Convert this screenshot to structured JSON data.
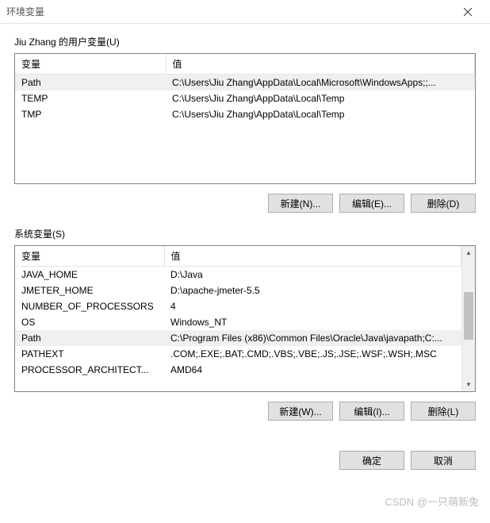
{
  "window": {
    "title": "环境变量"
  },
  "user_section": {
    "label": "Jiu Zhang 的用户变量(U)",
    "headers": {
      "name": "变量",
      "value": "值"
    },
    "rows": [
      {
        "name": "Path",
        "value": "C:\\Users\\Jiu Zhang\\AppData\\Local\\Microsoft\\WindowsApps;;...",
        "selected": true
      },
      {
        "name": "TEMP",
        "value": "C:\\Users\\Jiu Zhang\\AppData\\Local\\Temp",
        "selected": false
      },
      {
        "name": "TMP",
        "value": "C:\\Users\\Jiu Zhang\\AppData\\Local\\Temp",
        "selected": false
      }
    ],
    "buttons": {
      "new": "新建(N)...",
      "edit": "编辑(E)...",
      "delete": "删除(D)"
    }
  },
  "system_section": {
    "label": "系统变量(S)",
    "headers": {
      "name": "变量",
      "value": "值"
    },
    "rows": [
      {
        "name": "JAVA_HOME",
        "value": "D:\\Java",
        "selected": false
      },
      {
        "name": "JMETER_HOME",
        "value": "D:\\apache-jmeter-5.5",
        "selected": false
      },
      {
        "name": "NUMBER_OF_PROCESSORS",
        "value": "4",
        "selected": false
      },
      {
        "name": "OS",
        "value": "Windows_NT",
        "selected": false
      },
      {
        "name": "Path",
        "value": "C:\\Program Files (x86)\\Common Files\\Oracle\\Java\\javapath;C:...",
        "selected": true
      },
      {
        "name": "PATHEXT",
        "value": ".COM;.EXE;.BAT;.CMD;.VBS;.VBE;.JS;.JSE;.WSF;.WSH;.MSC",
        "selected": false
      },
      {
        "name": "PROCESSOR_ARCHITECT...",
        "value": "AMD64",
        "selected": false
      }
    ],
    "buttons": {
      "new": "新建(W)...",
      "edit": "编辑(I)...",
      "delete": "删除(L)"
    }
  },
  "dialog_buttons": {
    "ok": "确定",
    "cancel": "取消"
  },
  "watermark": "CSDN @一只萌新兔"
}
